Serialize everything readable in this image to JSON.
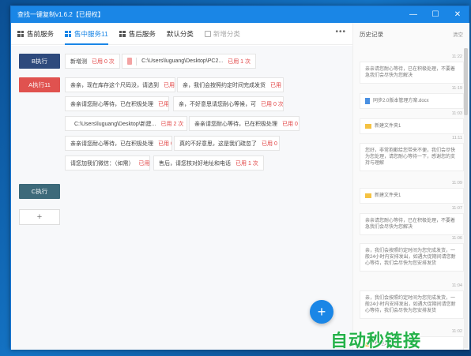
{
  "window": {
    "title": "查找一键复制v1.6.2【已授权】"
  },
  "tabs": [
    {
      "label": "售前服务"
    },
    {
      "label": "售中服务11"
    },
    {
      "label": "售后服务"
    },
    {
      "label": "默认分类"
    },
    {
      "label": "新增分类"
    }
  ],
  "groups": {
    "b": "B执行",
    "a": "A执行11",
    "c": "C执行"
  },
  "items": {
    "r1c1": {
      "text": "新增测",
      "uses": "已用 0 次"
    },
    "r1c2": {
      "text": "C:\\Users\\luguang\\Desktop\\PC2...",
      "uses": "已用 1 次"
    },
    "r2c1": {
      "text": "亲亲，现在库存这个尺码没，请选到",
      "uses": "已用 0 次"
    },
    "r2c2": {
      "text": "亲，我们会按照约定时间完成发货",
      "uses": "已用 2 次"
    },
    "r3c1": {
      "text": "亲亲请您耐心等待，已在积极处理",
      "uses": "已用 2 次"
    },
    "r3c2": {
      "text": "亲，不好意思请您耐心等候，可",
      "uses": "已用 0 次"
    },
    "r4c1": {
      "text": "C:\\Users\\luguang\\Desktop\\新建...",
      "uses": "已用 2 次"
    },
    "r4c2": {
      "text": "亲亲请您耐心等待，已在积极处理",
      "uses": "已用 0 次"
    },
    "r5c1": {
      "text": "亲亲请您耐心等待，已在积极处理",
      "uses": "已用 0 次"
    },
    "r5c2": {
      "text": "真的不好意思，这是我们疏忽了",
      "uses": "已用 0 次"
    },
    "r6c1": {
      "text": "请您加我们微信：（如需）",
      "uses": "已用 0 次"
    },
    "r6c2": {
      "text": "售后，请您核对好地址和电话",
      "uses": "已用 1 次"
    }
  },
  "add_label": "+",
  "fab_label": "+",
  "more_label": "•••",
  "history": {
    "title": "历史记录",
    "clear_label": "清空",
    "entries": [
      {
        "time": "11:22",
        "text": "亲亲请您耐心等待，已在积极处理，不要着急我们会尽快为您解决"
      },
      {
        "time": "11:19",
        "text": "同步2.0版本管理方案.docx"
      },
      {
        "time": "11:03",
        "text": "新建文件夹1"
      },
      {
        "time": "11:11",
        "text": "您好，非常抱歉给您带来不便，我们会尽快为您处理，请您耐心等待一下，感谢您的支持与理解"
      },
      {
        "time": "11:09",
        "text": "新建文件夹1"
      },
      {
        "time": "11:07",
        "text": "亲亲请您耐心等待，已在积极处理，不要着急我们会尽快为您解决"
      },
      {
        "time": "11:06",
        "text": "亲，我们会按照约定时间为您完成发货，一般24小时内安排发出，如遇大促期间请您耐心等待，我们会尽快为您安排发货"
      },
      {
        "time": "11:04",
        "text": "亲，我们会按照约定时间为您完成发货，一般24小时内安排发出，如遇大促期间请您耐心等待，我们会尽快为您安排发货"
      },
      {
        "time": "11:02",
        "text": "新建文件夹"
      }
    ]
  },
  "watermark": "自动秒链接",
  "colors": {
    "accent": "#1a86e6",
    "group_b": "#2e4a7d",
    "group_a": "#e0524f",
    "group_c": "#3d6a7a",
    "uses": "#e04040"
  }
}
